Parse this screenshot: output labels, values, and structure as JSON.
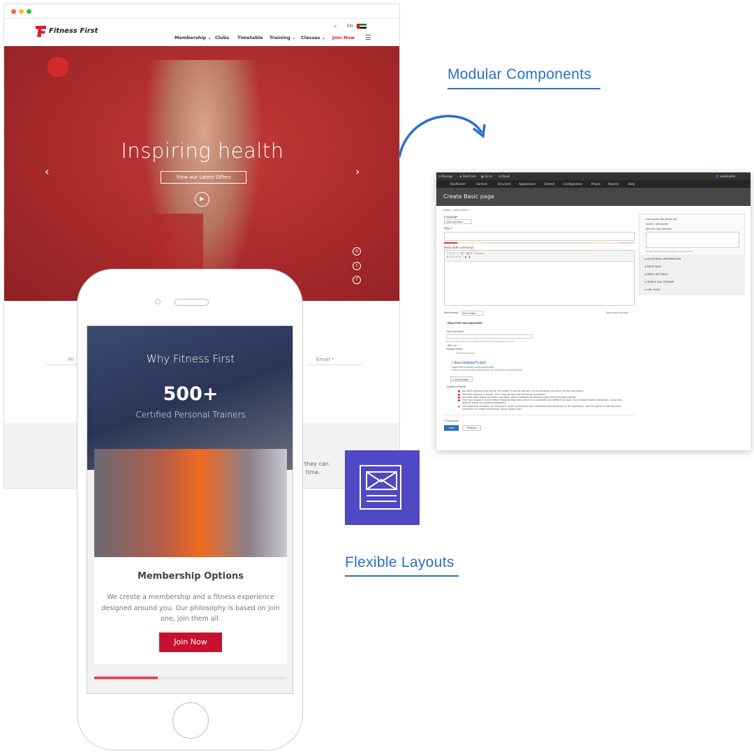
{
  "website": {
    "logo": "Fitness First",
    "lang": "EN",
    "nav": [
      "Membership",
      "Clubs",
      "Timetable",
      "Training",
      "Classes",
      "Join Now"
    ],
    "hero_title": "Inspiring health",
    "hero_button": "View our Latest Offers",
    "form_first": "Fir",
    "form_email": "Email *",
    "partial_text_1": "they can.",
    "partial_text_2": "time.",
    "accent": "#c8102e"
  },
  "mobile": {
    "why_title": "Why Fitness First",
    "stat": "500+",
    "stat_label": "Certified Personal Trainers",
    "card_title": "Membership Options",
    "card_text": [
      "We create a membership and a fitness experience",
      "designed around you. Our philosophy is based on join",
      "one, join them all."
    ],
    "join_button": "Join Now",
    "carousel_progress": 0.33
  },
  "admin": {
    "toolbar": [
      "Manage",
      "Shortcuts",
      "Go to",
      "Devel"
    ],
    "user": "webmaster",
    "menu": [
      "Dashboard",
      "Content",
      "Structure",
      "Appearance",
      "Extend",
      "Configuration",
      "People",
      "Reports",
      "Help"
    ],
    "page_title": "Create Basic page",
    "breadcrumb": "Home » Add content",
    "language_label": "Language",
    "language_value": "- Not specified -",
    "title_label": "Title *",
    "body_label": "Body (Edit summary)",
    "source_label": "Source",
    "text_format_label": "Text format",
    "text_format_value": "Rich editor",
    "about_formats": "About text formats",
    "seo_section": "REAL-TIME SEO ANALYZER",
    "focus_label": "Focus keyword",
    "focus_help": "Pick the main keyword or keyphrase that this post/page is about.",
    "seo_na": "SEO: na",
    "snippet_label": "Snippet editor",
    "snippet_preview": "Snippet preview",
    "snippet_title": "| dev.varbase7c1b1",
    "snippet_url": "rsbot7.dev.in.varbit.com/sample-post/",
    "snippet_desc": "Please provide a meta description by editing the snippet below.",
    "edit_snippet": "Edit snippet",
    "analysis_label": "Content analysis",
    "analysis": [
      {
        "text": "No focus keyword was set for this page. If you do not set a focus keyword, no score can be calculated.",
        "status": "bad"
      },
      {
        "text": "The text contains 0 words. This is far too low and should be increased.",
        "status": "bad"
      },
      {
        "text": "No meta description has been specified, search engines will display copy from the page instead.",
        "status": "bad"
      },
      {
        "text": "The copy scores 0 in the Flesch Reading Ease test, which is considered very difficult to read. Try to make shorter sentences, using less difficult words to improve readability.",
        "status": "bad"
      },
      {
        "text": "The page title contains 19 characters, which is less than the recommended minimum of 35 characters. Use the space to add keyword variations or create compelling call-to-action copy.",
        "status": "ok"
      }
    ],
    "published": "Published",
    "save": "Save",
    "preview": "Preview",
    "last_saved": "Last saved: Not saved yet",
    "author": "Author: webmaster",
    "revision_label": "Revision log message",
    "revision_help": "Briefly describe the changes you have made.",
    "sidebar_sections": [
      "AUTHORING INFORMATION",
      "META TAGS",
      "MENU SETTINGS",
      "SIMPLE XML SITEMAP",
      "URL ALIAS"
    ]
  },
  "labels": {
    "modular": "Modular Components",
    "flexible": "Flexible Layouts",
    "color": "#2a6fc9",
    "icon_bg": "#5048c4"
  }
}
